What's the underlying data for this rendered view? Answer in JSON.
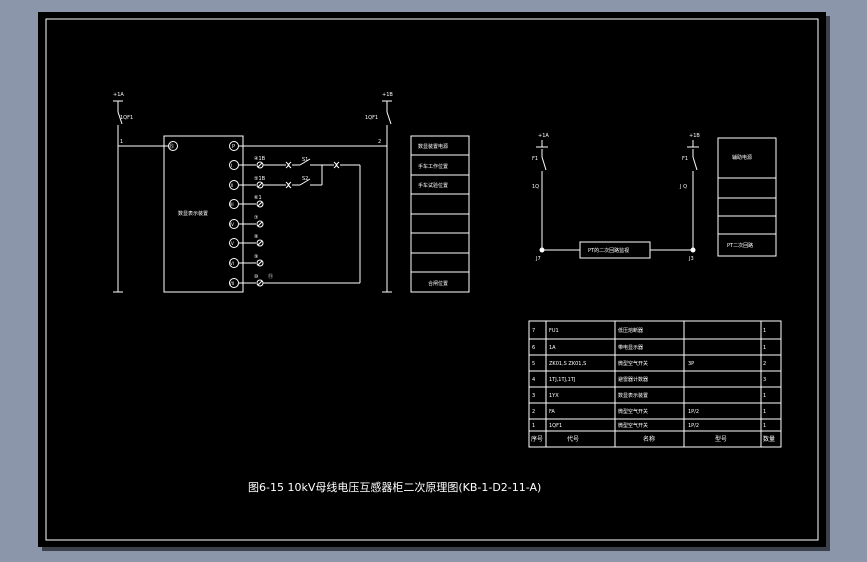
{
  "colors": {
    "background": "#8c96aa",
    "sheet": "#000000",
    "line": "#ffffff",
    "shadow": "#3c414b"
  },
  "title": "图6-15 10kV母线电压互感器柜二次原理图(KB-1-D2-11-A)",
  "left_circuit": {
    "left_breaker": "1QF1",
    "left_breaker_top": "+1A",
    "right_breaker": "1QF1",
    "right_breaker_top": "+1B",
    "left_wire": "1",
    "right_wire": "2",
    "device_label": "数显表示装置",
    "top_terminal_left": "⑮",
    "top_terminal_right": "P",
    "switch_1": "S1",
    "switch_2": "S2",
    "terminals": [
      {
        "circle": "I",
        "code": "④1B"
      },
      {
        "circle": "II",
        "code": "⑤1B"
      },
      {
        "circle": "III",
        "code": "⑥1"
      },
      {
        "circle": "IV",
        "code": "⑦"
      },
      {
        "circle": "V",
        "code": "⑧"
      },
      {
        "circle": "VI",
        "code": "⑨"
      },
      {
        "circle": "VII",
        "code": "⑩"
      },
      {
        "circle": "VIII",
        "code": "⑪"
      }
    ],
    "legend": [
      "数显装置电源",
      "手车工作位置",
      "手车试验位置",
      "",
      "",
      "",
      "合闸位置"
    ]
  },
  "right_circuit": {
    "left_top": "+1A",
    "left_fuse": "F1",
    "left_bottom": "1Q",
    "left_node": "J7",
    "right_top": "+1B",
    "right_fuse": "F1",
    "right_bottom": "J Q",
    "right_node": "J3",
    "center_box": "PT的二次回路监视",
    "legend": [
      "辅助电源",
      "",
      "",
      "PT二次回路"
    ]
  },
  "parts_table": {
    "rows": [
      {
        "no": "7",
        "code": "FU1",
        "name": "低压熔断器",
        "spec": "",
        "qty": "1"
      },
      {
        "no": "6",
        "code": "1A",
        "name": "带电显示器",
        "spec": "",
        "qty": "1"
      },
      {
        "no": "5",
        "code": "ZK01,S  ZK01,S",
        "name": "微型空气开关",
        "spec": "3P",
        "qty": "2"
      },
      {
        "no": "4",
        "code": "1TJ,1TJ,1TJ",
        "name": "避雷器计数器",
        "spec": "",
        "qty": "3"
      },
      {
        "no": "3",
        "code": "1YX",
        "name": "数显表示装置",
        "spec": "",
        "qty": "1"
      },
      {
        "no": "2",
        "code": "FA",
        "name": "微型空气开关",
        "spec": "1P/2",
        "qty": "1"
      },
      {
        "no": "1",
        "code": "1QF1",
        "name": "微型空气开关",
        "spec": "1P/2",
        "qty": "1"
      }
    ],
    "header": {
      "no": "序号",
      "code": "代号",
      "name": "名称",
      "spec": "型号",
      "qty": "数量"
    }
  }
}
